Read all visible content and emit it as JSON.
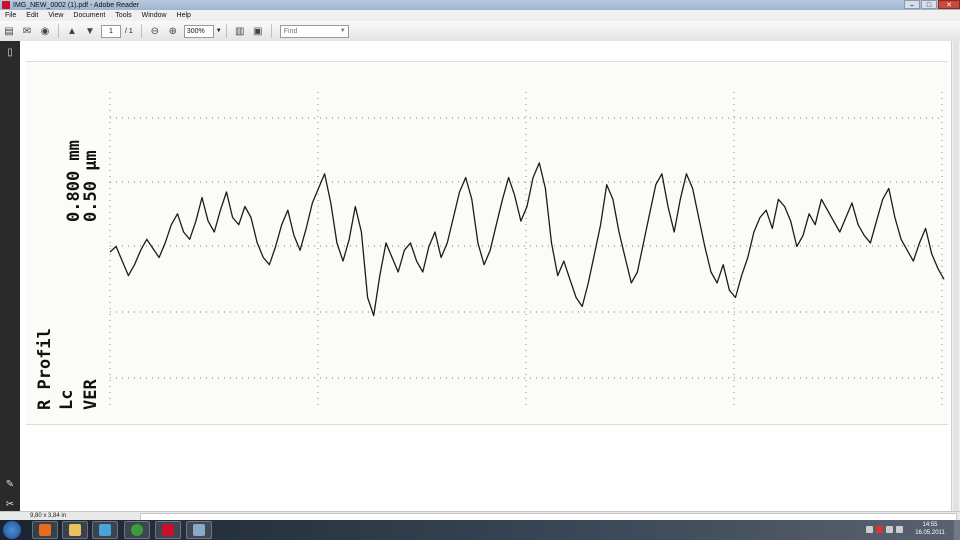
{
  "window": {
    "title": "IMG_NEW_0002 (1).pdf - Adobe Reader"
  },
  "menu": [
    "File",
    "Edit",
    "View",
    "Document",
    "Tools",
    "Window",
    "Help"
  ],
  "toolbar": {
    "page_value": "1",
    "page_count": "/ 1",
    "zoom_value": "300%",
    "find_placeholder": "Find"
  },
  "status": {
    "page_size": "9,80 x 3,84 in"
  },
  "document": {
    "scale_h": "0.800 mm",
    "scale_v": "0.50 µm",
    "label_profile": "R Profil",
    "label_lc": "Lc",
    "label_ver": "VER"
  },
  "chart_data": {
    "type": "line",
    "title": "",
    "xlabel": "",
    "ylabel": "",
    "series": [
      {
        "values": [
          0.55,
          0.58,
          0.5,
          0.42,
          0.48,
          0.56,
          0.62,
          0.57,
          0.52,
          0.6,
          0.7,
          0.76,
          0.66,
          0.62,
          0.72,
          0.85,
          0.72,
          0.66,
          0.78,
          0.88,
          0.74,
          0.7,
          0.8,
          0.74,
          0.6,
          0.52,
          0.48,
          0.58,
          0.7,
          0.78,
          0.64,
          0.56,
          0.68,
          0.82,
          0.9,
          0.98,
          0.82,
          0.6,
          0.5,
          0.62,
          0.8,
          0.66,
          0.3,
          0.2,
          0.42,
          0.6,
          0.52,
          0.44,
          0.56,
          0.6,
          0.5,
          0.44,
          0.58,
          0.66,
          0.52,
          0.6,
          0.74,
          0.88,
          0.96,
          0.84,
          0.6,
          0.48,
          0.56,
          0.7,
          0.84,
          0.96,
          0.86,
          0.72,
          0.8,
          0.96,
          1.04,
          0.9,
          0.6,
          0.42,
          0.5,
          0.4,
          0.3,
          0.25,
          0.38,
          0.54,
          0.7,
          0.92,
          0.84,
          0.66,
          0.52,
          0.38,
          0.44,
          0.6,
          0.76,
          0.92,
          0.98,
          0.8,
          0.66,
          0.84,
          0.98,
          0.9,
          0.74,
          0.58,
          0.44,
          0.38,
          0.48,
          0.34,
          0.3,
          0.42,
          0.52,
          0.66,
          0.74,
          0.78,
          0.68,
          0.84,
          0.8,
          0.72,
          0.58,
          0.64,
          0.76,
          0.7,
          0.84,
          0.78,
          0.72,
          0.66,
          0.74,
          0.82,
          0.7,
          0.64,
          0.6,
          0.72,
          0.84,
          0.9,
          0.74,
          0.62,
          0.56,
          0.5,
          0.6,
          0.68,
          0.54,
          0.46,
          0.4
        ]
      }
    ],
    "ylim": [
      0,
      1.1
    ],
    "grid": true
  }
}
